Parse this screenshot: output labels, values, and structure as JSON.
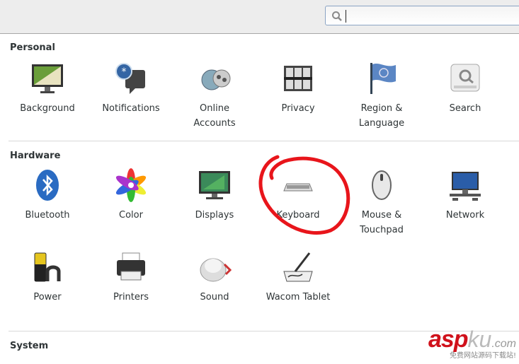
{
  "toolbar": {
    "search": {
      "value": "",
      "placeholder": "",
      "icon": "search-icon"
    }
  },
  "sections": [
    {
      "title": "Personal",
      "items": [
        {
          "label": "Background",
          "icon": "background-icon"
        },
        {
          "label": "Notifications",
          "icon": "notifications-icon"
        },
        {
          "label": "Online\nAccounts",
          "icon": "online-accounts-icon"
        },
        {
          "label": "Privacy",
          "icon": "privacy-icon"
        },
        {
          "label": "Region &\nLanguage",
          "icon": "region-flag-icon"
        },
        {
          "label": "Search",
          "icon": "search-icon"
        }
      ]
    },
    {
      "title": "Hardware",
      "items": [
        {
          "label": "Bluetooth",
          "icon": "bluetooth-icon"
        },
        {
          "label": "Color",
          "icon": "color-icon"
        },
        {
          "label": "Displays",
          "icon": "displays-icon"
        },
        {
          "label": "Keyboard",
          "icon": "keyboard-icon"
        },
        {
          "label": "Mouse &\nTouchpad",
          "icon": "mouse-icon"
        },
        {
          "label": "Network",
          "icon": "network-icon"
        },
        {
          "label": "Power",
          "icon": "power-icon"
        },
        {
          "label": "Printers",
          "icon": "printer-icon"
        },
        {
          "label": "Sound",
          "icon": "sound-icon"
        },
        {
          "label": "Wacom Tablet",
          "icon": "wacom-tablet-icon"
        }
      ]
    },
    {
      "title": "System",
      "items": []
    }
  ],
  "annotation": {
    "color": "#e8151b",
    "target": "Keyboard"
  },
  "watermark": {
    "brand": "asp",
    "brand2": "ku",
    "tld": ".com",
    "slogan": "免费网站源码下载站!"
  }
}
